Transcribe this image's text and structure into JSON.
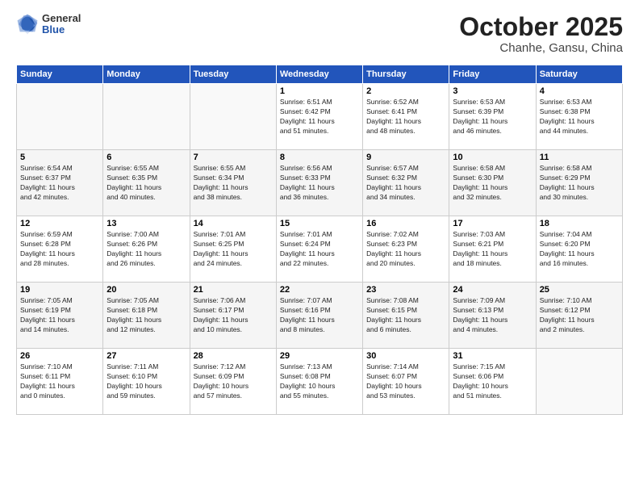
{
  "header": {
    "logo": {
      "line1": "General",
      "line2": "Blue"
    },
    "month": "October 2025",
    "location": "Chanhe, Gansu, China"
  },
  "weekdays": [
    "Sunday",
    "Monday",
    "Tuesday",
    "Wednesday",
    "Thursday",
    "Friday",
    "Saturday"
  ],
  "weeks": [
    [
      {
        "day": "",
        "info": ""
      },
      {
        "day": "",
        "info": ""
      },
      {
        "day": "",
        "info": ""
      },
      {
        "day": "1",
        "info": "Sunrise: 6:51 AM\nSunset: 6:42 PM\nDaylight: 11 hours\nand 51 minutes."
      },
      {
        "day": "2",
        "info": "Sunrise: 6:52 AM\nSunset: 6:41 PM\nDaylight: 11 hours\nand 48 minutes."
      },
      {
        "day": "3",
        "info": "Sunrise: 6:53 AM\nSunset: 6:39 PM\nDaylight: 11 hours\nand 46 minutes."
      },
      {
        "day": "4",
        "info": "Sunrise: 6:53 AM\nSunset: 6:38 PM\nDaylight: 11 hours\nand 44 minutes."
      }
    ],
    [
      {
        "day": "5",
        "info": "Sunrise: 6:54 AM\nSunset: 6:37 PM\nDaylight: 11 hours\nand 42 minutes."
      },
      {
        "day": "6",
        "info": "Sunrise: 6:55 AM\nSunset: 6:35 PM\nDaylight: 11 hours\nand 40 minutes."
      },
      {
        "day": "7",
        "info": "Sunrise: 6:55 AM\nSunset: 6:34 PM\nDaylight: 11 hours\nand 38 minutes."
      },
      {
        "day": "8",
        "info": "Sunrise: 6:56 AM\nSunset: 6:33 PM\nDaylight: 11 hours\nand 36 minutes."
      },
      {
        "day": "9",
        "info": "Sunrise: 6:57 AM\nSunset: 6:32 PM\nDaylight: 11 hours\nand 34 minutes."
      },
      {
        "day": "10",
        "info": "Sunrise: 6:58 AM\nSunset: 6:30 PM\nDaylight: 11 hours\nand 32 minutes."
      },
      {
        "day": "11",
        "info": "Sunrise: 6:58 AM\nSunset: 6:29 PM\nDaylight: 11 hours\nand 30 minutes."
      }
    ],
    [
      {
        "day": "12",
        "info": "Sunrise: 6:59 AM\nSunset: 6:28 PM\nDaylight: 11 hours\nand 28 minutes."
      },
      {
        "day": "13",
        "info": "Sunrise: 7:00 AM\nSunset: 6:26 PM\nDaylight: 11 hours\nand 26 minutes."
      },
      {
        "day": "14",
        "info": "Sunrise: 7:01 AM\nSunset: 6:25 PM\nDaylight: 11 hours\nand 24 minutes."
      },
      {
        "day": "15",
        "info": "Sunrise: 7:01 AM\nSunset: 6:24 PM\nDaylight: 11 hours\nand 22 minutes."
      },
      {
        "day": "16",
        "info": "Sunrise: 7:02 AM\nSunset: 6:23 PM\nDaylight: 11 hours\nand 20 minutes."
      },
      {
        "day": "17",
        "info": "Sunrise: 7:03 AM\nSunset: 6:21 PM\nDaylight: 11 hours\nand 18 minutes."
      },
      {
        "day": "18",
        "info": "Sunrise: 7:04 AM\nSunset: 6:20 PM\nDaylight: 11 hours\nand 16 minutes."
      }
    ],
    [
      {
        "day": "19",
        "info": "Sunrise: 7:05 AM\nSunset: 6:19 PM\nDaylight: 11 hours\nand 14 minutes."
      },
      {
        "day": "20",
        "info": "Sunrise: 7:05 AM\nSunset: 6:18 PM\nDaylight: 11 hours\nand 12 minutes."
      },
      {
        "day": "21",
        "info": "Sunrise: 7:06 AM\nSunset: 6:17 PM\nDaylight: 11 hours\nand 10 minutes."
      },
      {
        "day": "22",
        "info": "Sunrise: 7:07 AM\nSunset: 6:16 PM\nDaylight: 11 hours\nand 8 minutes."
      },
      {
        "day": "23",
        "info": "Sunrise: 7:08 AM\nSunset: 6:15 PM\nDaylight: 11 hours\nand 6 minutes."
      },
      {
        "day": "24",
        "info": "Sunrise: 7:09 AM\nSunset: 6:13 PM\nDaylight: 11 hours\nand 4 minutes."
      },
      {
        "day": "25",
        "info": "Sunrise: 7:10 AM\nSunset: 6:12 PM\nDaylight: 11 hours\nand 2 minutes."
      }
    ],
    [
      {
        "day": "26",
        "info": "Sunrise: 7:10 AM\nSunset: 6:11 PM\nDaylight: 11 hours\nand 0 minutes."
      },
      {
        "day": "27",
        "info": "Sunrise: 7:11 AM\nSunset: 6:10 PM\nDaylight: 10 hours\nand 59 minutes."
      },
      {
        "day": "28",
        "info": "Sunrise: 7:12 AM\nSunset: 6:09 PM\nDaylight: 10 hours\nand 57 minutes."
      },
      {
        "day": "29",
        "info": "Sunrise: 7:13 AM\nSunset: 6:08 PM\nDaylight: 10 hours\nand 55 minutes."
      },
      {
        "day": "30",
        "info": "Sunrise: 7:14 AM\nSunset: 6:07 PM\nDaylight: 10 hours\nand 53 minutes."
      },
      {
        "day": "31",
        "info": "Sunrise: 7:15 AM\nSunset: 6:06 PM\nDaylight: 10 hours\nand 51 minutes."
      },
      {
        "day": "",
        "info": ""
      }
    ]
  ]
}
